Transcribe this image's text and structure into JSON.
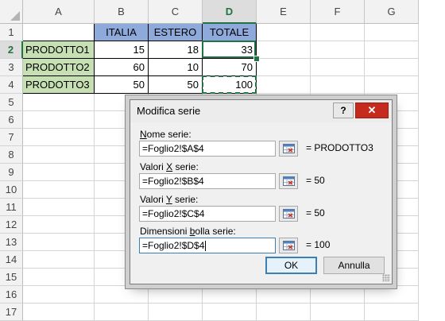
{
  "sheet": {
    "columns": [
      "A",
      "B",
      "C",
      "D",
      "E",
      "F",
      "G"
    ],
    "selected_column": "D",
    "rows": [
      "1",
      "2",
      "3",
      "4",
      "5",
      "6",
      "7",
      "8",
      "9",
      "10",
      "11",
      "12",
      "13",
      "14",
      "15",
      "16",
      "17"
    ],
    "selected_row": "2",
    "cells": {
      "A2": "PRODOTTO1",
      "A3": "PRODOTTO2",
      "A4": "PRODOTTO3",
      "B1": "ITALIA",
      "C1": "ESTERO",
      "D1": "TOTALE",
      "B2": "15",
      "C2": "18",
      "D2": "33",
      "B3": "60",
      "C3": "10",
      "D3": "70",
      "B4": "50",
      "C4": "50",
      "D4": "100"
    },
    "colors": {
      "header_fill": "#8eaadb",
      "name_fill": "#c6e0b4",
      "selection": "#217346"
    }
  },
  "dialog": {
    "title": "Modifica serie",
    "help_label": "?",
    "close_label": "✕",
    "fields": [
      {
        "label_pre": "",
        "label_u": "N",
        "label_post": "ome serie:",
        "value": "=Foglio2!$A$4",
        "result": "= PRODOTTO3"
      },
      {
        "label_pre": "Valori ",
        "label_u": "X",
        "label_post": " serie:",
        "value": "=Foglio2!$B$4",
        "result": "= 50"
      },
      {
        "label_pre": "Valori ",
        "label_u": "Y",
        "label_post": " serie:",
        "value": "=Foglio2!$C$4",
        "result": "= 50"
      },
      {
        "label_pre": "Dimensioni ",
        "label_u": "b",
        "label_post": "olla serie:",
        "value": "=Foglio2!$D$4",
        "result": "= 100"
      }
    ],
    "ok_label": "OK",
    "cancel_label": "Annulla",
    "collapse_icon": "range-select-icon"
  }
}
